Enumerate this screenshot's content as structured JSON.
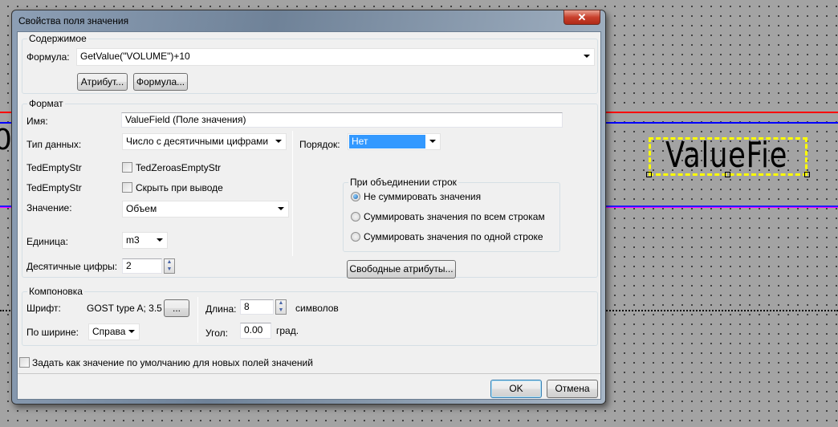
{
  "canvas": {
    "field_text": "ValueFie",
    "left_glyph": "0",
    "colors": {
      "red_line": "#ff0000",
      "blue_line": "#0000ff",
      "selection": "#ffff00"
    }
  },
  "dialog": {
    "title": "Свойства поля значения",
    "content_group": {
      "title": "Содержимое",
      "formula_label": "Формула:",
      "formula_value": "GetValue(\"VOLUME\")+10",
      "attribute_button": "Атрибут...",
      "formula_button": "Формула..."
    },
    "format_group": {
      "title": "Формат",
      "name_label": "Имя:",
      "name_value": "ValueField (Поле значения)",
      "datatype_label": "Тип данных:",
      "datatype_value": "Число с десятичными цифрами",
      "order_label": "Порядок:",
      "order_value": "Нет",
      "row1_label": "TedEmptyStr",
      "row1_checkbox": "TedZeroasEmptyStr",
      "row2_label": "TedEmptyStr",
      "row2_checkbox": "Скрыть при выводе",
      "value_label": "Значение:",
      "value_value": "Объем",
      "unit_label": "Единица:",
      "unit_value": "m3",
      "decimals_label": "Десятичные цифры:",
      "decimals_value": "2",
      "merge_group": {
        "title": "При объединении строк",
        "options": [
          "Не суммировать значения",
          "Суммировать значения по всем строкам",
          "Суммировать значения по одной строке"
        ],
        "selected": 0
      },
      "free_attributes_button": "Свободные атрибуты..."
    },
    "layout_group": {
      "title": "Компоновка",
      "font_label": "Шрифт:",
      "font_value": "GOST type A; 3.5",
      "font_button": "...",
      "length_label": "Длина:",
      "length_value": "8",
      "length_unit": "символов",
      "width_label": "По ширине:",
      "width_value": "Справа",
      "angle_label": "Угол:",
      "angle_value": "0.00",
      "angle_unit": "град."
    },
    "default_checkbox": "Задать как значение по умолчанию для новых полей значений",
    "ok_button": "OK",
    "cancel_button": "Отмена"
  }
}
